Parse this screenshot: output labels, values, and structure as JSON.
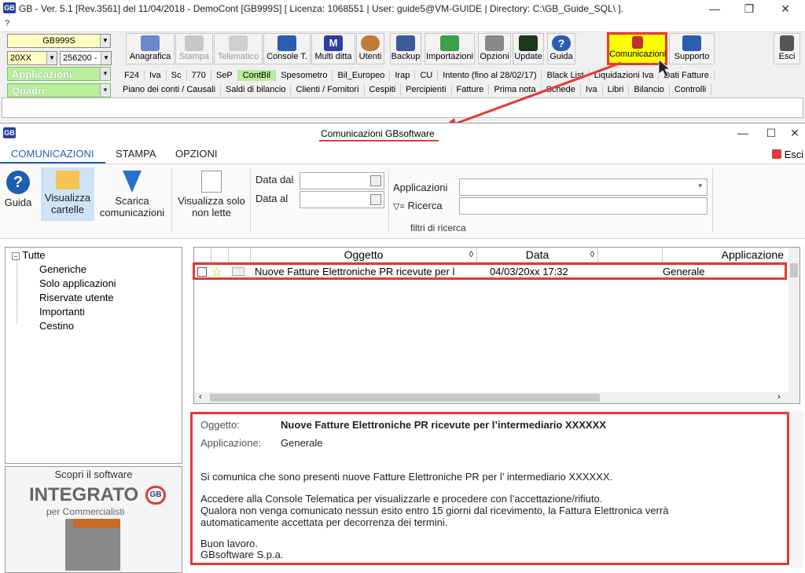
{
  "window": {
    "logo_text": "GB",
    "title": "GB - Ver. 5.1 [Rev.3561] del 11/04/2018 - DemoCont [GB999S]   [ Licenza: 1068551 | User: guide5@VM-GUIDE | Directory: C:\\GB_Guide_SQL\\ ].",
    "help_menu": "?",
    "minimize": "—",
    "maximize": "❐",
    "close": "✕"
  },
  "toolbar": {
    "company_code": "GB999S",
    "year": "20XX",
    "account": "256200 -",
    "applicazioni_label": "Applicazioni",
    "quadri_label": "Quadri",
    "buttons": [
      {
        "label": "Anagrafica"
      },
      {
        "label": "Stampa"
      },
      {
        "label": "Telematico"
      },
      {
        "label": "Console T."
      },
      {
        "label": "Multi ditta"
      },
      {
        "label": "Utenti"
      },
      {
        "label": "Backup"
      },
      {
        "label": "Importazioni"
      },
      {
        "label": "Opzioni"
      },
      {
        "label": "Update"
      },
      {
        "label": "Guida"
      },
      {
        "label": "Comunicazioni"
      },
      {
        "label": "Supporto"
      },
      {
        "label": "Esci"
      }
    ],
    "app_tabs": [
      "F24",
      "Iva",
      "Sc",
      "770",
      "SeP",
      "ContBil",
      "Spesometro",
      "Bil_Europeo",
      "Irap",
      "CU",
      "Intento (fino al 28/02/17)",
      "Black List",
      "Liquidazioni Iva",
      "Dati Fatture"
    ],
    "quadri_tabs": [
      "Piano dei conti / Causali",
      "Saldi di bilancio",
      "Clienti / Fornitori",
      "Cespiti",
      "Percipienti",
      "Fatture",
      "Prima nota",
      "Schede",
      "Iva",
      "Libri",
      "Bilancio",
      "Controlli"
    ]
  },
  "dialog": {
    "title": "Comunicazioni GBsoftware",
    "tabs": [
      "COMUNICAZIONI",
      "STAMPA",
      "OPZIONI"
    ],
    "esci": "Esci",
    "ribbon": {
      "guida": "Guida",
      "visualizza_cartelle": "Visualizza cartelle",
      "scarica_comunicazioni": "Scarica comunicazioni",
      "visualizza_non_lette": "Visualizza solo non lette",
      "data_dal": "Data dal",
      "data_al": "Data al",
      "applicazioni": "Applicazioni",
      "ricerca": "Ricerca",
      "filtri": "filtri di ricerca"
    },
    "tree": {
      "root": "Tutte",
      "items": [
        "Generiche",
        "Solo applicazioni",
        "Riservate utente",
        "Importanti",
        "Cestino"
      ]
    },
    "promo": {
      "line1": "Scopri il software",
      "brand": "INTEGRATO",
      "brand_badge": "GB",
      "sub": "per Commercialisti"
    },
    "list": {
      "columns": [
        "Oggetto",
        "Data",
        "Applicazione"
      ],
      "rows": [
        {
          "subject": "Nuove Fatture Elettroniche PR ricevute per l",
          "date": "04/03/20xx  17:32",
          "app": "Generale"
        }
      ]
    },
    "detail": {
      "oggetto_label": "Oggetto:",
      "oggetto_value": "Nuove Fatture Elettroniche PR ricevute per l’intermediario XXXXXX",
      "applicazione_label": "Applicazione:",
      "applicazione_value": "Generale",
      "p1": "Si comunica che sono presenti nuove Fatture Elettroniche PR per l’ intermediario XXXXXX.",
      "p2a": "Accedere alla Console Telematica per visualizzarle e procedere con l’accettazione/rifiuto.",
      "p2b": "Qualora non venga comunicato nessun esito entro 15 giorni dal ricevimento, la Fattura Elettronica verrà",
      "p2c": "automaticamente accettata per decorrenza dei termini.",
      "p3a": "Buon lavoro.",
      "p3b": "GBsoftware S.p.a."
    }
  },
  "colors": {
    "accent_red": "#e53935",
    "tab_green": "#b8ee9c",
    "comunicazioni_yellow": "#ffff00",
    "ribbon_blue": "#1f5fb2"
  }
}
